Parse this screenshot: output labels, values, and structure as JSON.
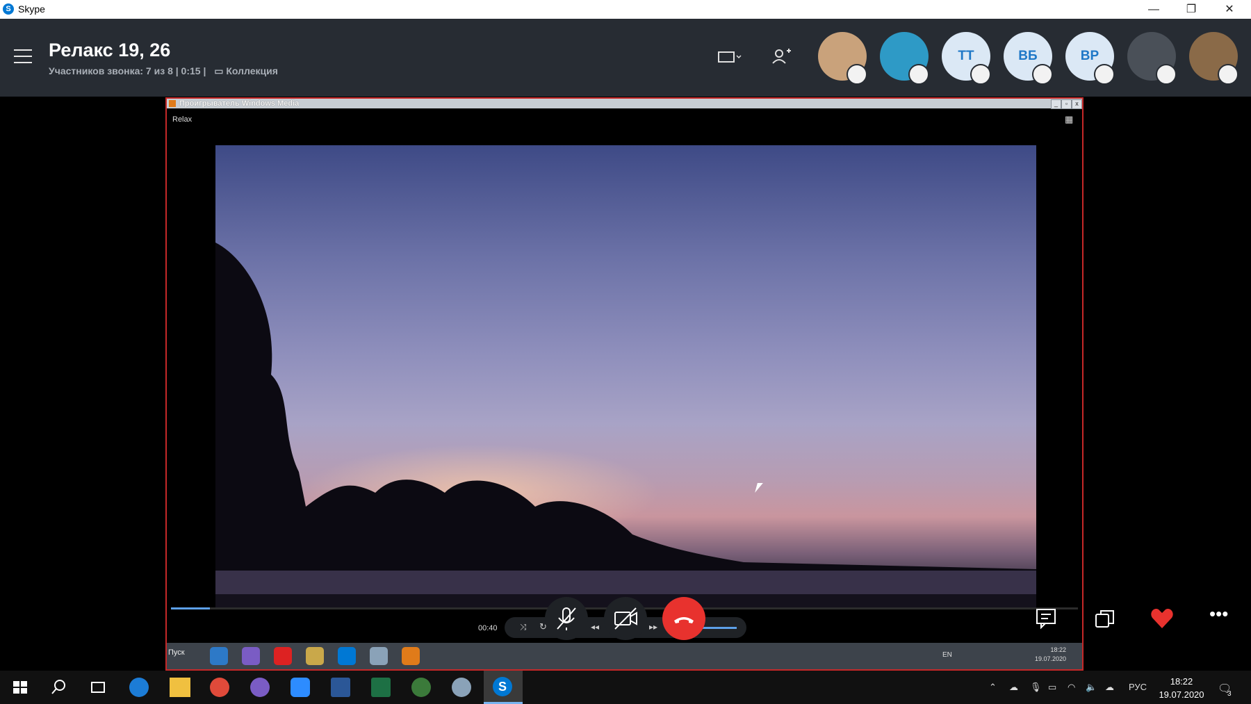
{
  "app": {
    "title": "Skype"
  },
  "window_controls": {
    "minimize": "—",
    "restore": "❐",
    "close": "✕"
  },
  "call": {
    "title": "Релакс 19, 26",
    "participants": "Участников звонка: 7 из 8 | 0:15 |",
    "collection": "Коллекция"
  },
  "participants": [
    {
      "type": "photo",
      "color": "#c9a27b"
    },
    {
      "type": "photo",
      "color": "#2e9ac6"
    },
    {
      "type": "initials",
      "initials": "ТТ"
    },
    {
      "type": "initials",
      "initials": "ВБ"
    },
    {
      "type": "initials",
      "initials": "ВР"
    },
    {
      "type": "photo",
      "color": "#4a5058"
    },
    {
      "type": "photo",
      "color": "#8a6a48"
    }
  ],
  "media_player": {
    "window_title": "Проигрыватель Windows Media",
    "track_name": "Relax",
    "elapsed": "00:40",
    "progress_fraction": 0.04
  },
  "remote_taskbar": {
    "start_label": "Пуск",
    "lang": "EN",
    "time": "18:22",
    "date": "19.07.2020"
  },
  "colors": {
    "header_bg": "#272c33",
    "hangup": "#e8322e",
    "accent": "#0078d4",
    "heart": "#e8322e"
  },
  "taskbar": {
    "lang": "РУС",
    "time": "18:22",
    "date": "19.07.2020",
    "notifications": "3"
  }
}
